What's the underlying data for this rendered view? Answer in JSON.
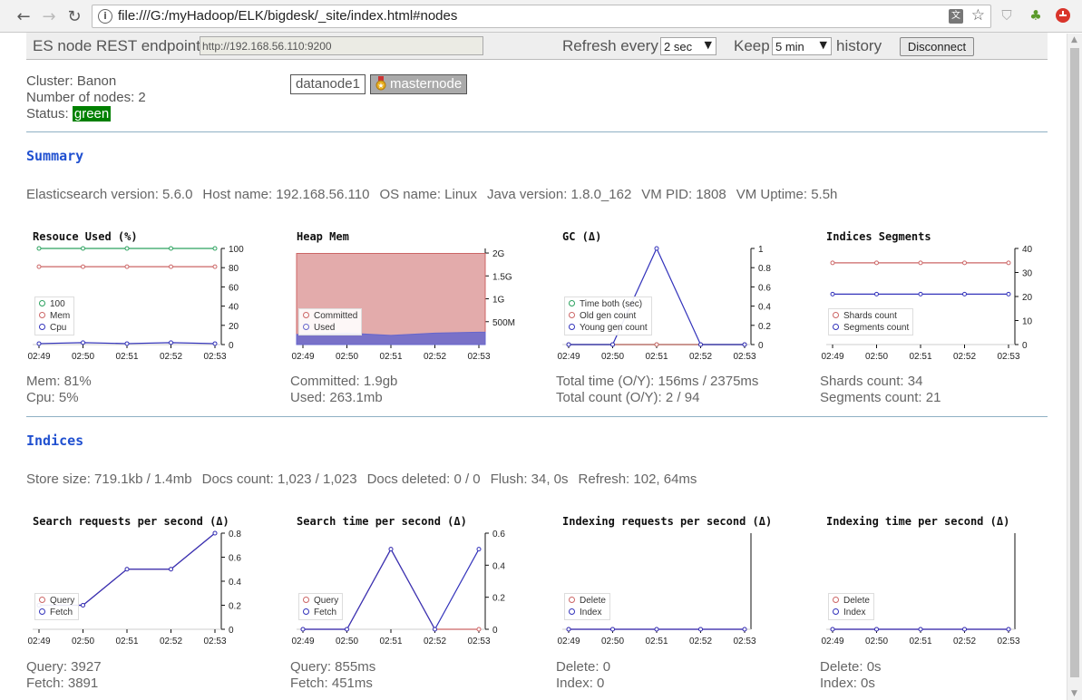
{
  "browser": {
    "url": "file:///G:/myHadoop/ELK/bigdesk/_site/index.html#nodes"
  },
  "header": {
    "endpoint_label": "ES node REST endpoint",
    "endpoint_value": "http://192.168.56.110:9200",
    "refresh_label": "Refresh every",
    "refresh_value": "2 sec",
    "keep_label": "Keep",
    "keep_value": "5 min",
    "history_label": "history",
    "disconnect_label": "Disconnect"
  },
  "cluster": {
    "name_line": "Cluster: Banon",
    "nodes_line": "Number of nodes: 2",
    "status_label": "Status:",
    "status_value": "green",
    "status_color": "#008000",
    "nodes": [
      "datanode1",
      "masternode"
    ]
  },
  "summary": {
    "title": "Summary",
    "stats": [
      "Elasticsearch version: 5.6.0",
      "Host name: 192.168.56.110",
      "OS name: Linux",
      "Java version: 1.8.0_162",
      "VM PID: 1808",
      "VM Uptime: 5.5h"
    ]
  },
  "indices": {
    "title": "Indices",
    "stats": [
      "Store size: 719.1kb / 1.4mb",
      "Docs count: 1,023 / 1,023",
      "Docs deleted: 0 / 0",
      "Flush: 34, 0s",
      "Refresh: 102, 64ms"
    ]
  },
  "chart_data": [
    {
      "id": "resources",
      "type": "line",
      "title": "Resouce Used (%)",
      "x": [
        "02:49",
        "02:50",
        "02:51",
        "02:52",
        "02:53"
      ],
      "ylim": [
        0,
        100
      ],
      "yticks": [
        "0",
        "20",
        "40",
        "60",
        "80",
        "100"
      ],
      "series": [
        {
          "name": "100",
          "color": "#2ca25f",
          "values": [
            100,
            100,
            100,
            100,
            100
          ]
        },
        {
          "name": "Mem",
          "color": "#cc6666",
          "values": [
            81,
            81,
            81,
            81,
            81
          ]
        },
        {
          "name": "Cpu",
          "color": "#3333bb",
          "values": [
            1,
            2,
            1,
            2,
            1
          ]
        }
      ],
      "metrics": [
        "Mem: 81%",
        "Cpu: 5%"
      ]
    },
    {
      "id": "heap",
      "type": "area",
      "title": "Heap Mem",
      "x": [
        "02:49",
        "02:50",
        "02:51",
        "02:52",
        "02:53"
      ],
      "ylim": [
        0,
        2.1
      ],
      "ytick_values": [
        0.5,
        1,
        1.5,
        2
      ],
      "yticks": [
        "500M",
        "1G",
        "1.5G",
        "2G"
      ],
      "series": [
        {
          "name": "Committed",
          "color": "#cc6666",
          "values": [
            1.99,
            1.99,
            1.99,
            1.99,
            1.99
          ]
        },
        {
          "name": "Used",
          "color": "#6666cc",
          "values": [
            0.22,
            0.25,
            0.2,
            0.25,
            0.27
          ]
        }
      ],
      "metrics": [
        "Committed: 1.9gb",
        "Used: 263.1mb"
      ]
    },
    {
      "id": "gc",
      "type": "line",
      "title": "GC (Δ)",
      "x": [
        "02:49",
        "02:50",
        "02:51",
        "02:52",
        "02:53"
      ],
      "ylim": [
        0,
        1
      ],
      "yticks": [
        "0",
        "0.2",
        "0.4",
        "0.6",
        "0.8",
        "1"
      ],
      "series": [
        {
          "name": "Time both (sec)",
          "color": "#2ca25f",
          "values": [
            0,
            0,
            0,
            0,
            0
          ]
        },
        {
          "name": "Old gen count",
          "color": "#cc6666",
          "values": [
            0,
            0,
            0,
            0,
            0
          ]
        },
        {
          "name": "Young gen count",
          "color": "#3333bb",
          "values": [
            0,
            0,
            1,
            0,
            0
          ]
        }
      ],
      "metrics": [
        "Total time (O/Y): 156ms / 2375ms",
        "Total count (O/Y): 2 / 94"
      ]
    },
    {
      "id": "segments",
      "type": "line",
      "title": "Indices Segments",
      "x": [
        "02:49",
        "02:50",
        "02:51",
        "02:52",
        "02:53"
      ],
      "ylim": [
        0,
        40
      ],
      "yticks": [
        "0",
        "10",
        "20",
        "30",
        "40"
      ],
      "series": [
        {
          "name": "Shards count",
          "color": "#cc6666",
          "values": [
            34,
            34,
            34,
            34,
            34
          ]
        },
        {
          "name": "Segments count",
          "color": "#3333bb",
          "values": [
            21,
            21,
            21,
            21,
            21
          ]
        }
      ],
      "metrics": [
        "Shards count: 34",
        "Segments count: 21"
      ]
    },
    {
      "id": "search-req",
      "type": "line",
      "title": "Search requests per second (Δ)",
      "x": [
        "02:49",
        "02:50",
        "02:51",
        "02:52",
        "02:53"
      ],
      "ylim": [
        0,
        0.8
      ],
      "yticks": [
        "0",
        "0.2",
        "0.4",
        "0.6",
        "0.8"
      ],
      "series": [
        {
          "name": "Query",
          "color": "#cc6666",
          "values": [
            0.2,
            0.2,
            0.5,
            0.5,
            0.8
          ]
        },
        {
          "name": "Fetch",
          "color": "#3333bb",
          "values": [
            0.2,
            0.2,
            0.5,
            0.5,
            0.8
          ]
        }
      ],
      "metrics": [
        "Query: 3927",
        "Fetch: 3891"
      ]
    },
    {
      "id": "search-time",
      "type": "line",
      "title": "Search time per second (Δ)",
      "x": [
        "02:49",
        "02:50",
        "02:51",
        "02:52",
        "02:53"
      ],
      "ylim": [
        0,
        0.6
      ],
      "yticks": [
        "0",
        "0.2",
        "0.4",
        "0.6"
      ],
      "series": [
        {
          "name": "Query",
          "color": "#cc6666",
          "values": [
            0,
            0,
            0.5,
            0,
            0
          ]
        },
        {
          "name": "Fetch",
          "color": "#3333bb",
          "values": [
            0,
            0,
            0.5,
            0,
            0.5
          ]
        }
      ],
      "metrics": [
        "Query: 855ms",
        "Fetch: 451ms"
      ]
    },
    {
      "id": "index-req",
      "type": "line",
      "title": "Indexing requests per second (Δ)",
      "x": [
        "02:49",
        "02:50",
        "02:51",
        "02:52",
        "02:53"
      ],
      "ylim": [
        0,
        1
      ],
      "yticks": [],
      "series": [
        {
          "name": "Delete",
          "color": "#cc6666",
          "values": [
            0,
            0,
            0,
            0,
            0
          ]
        },
        {
          "name": "Index",
          "color": "#3333bb",
          "values": [
            0,
            0,
            0,
            0,
            0
          ]
        }
      ],
      "metrics": [
        "Delete: 0",
        "Index: 0"
      ]
    },
    {
      "id": "index-time",
      "type": "line",
      "title": "Indexing time per second (Δ)",
      "x": [
        "02:49",
        "02:50",
        "02:51",
        "02:52",
        "02:53"
      ],
      "ylim": [
        0,
        1
      ],
      "yticks": [],
      "series": [
        {
          "name": "Delete",
          "color": "#cc6666",
          "values": [
            0,
            0,
            0,
            0,
            0
          ]
        },
        {
          "name": "Index",
          "color": "#3333bb",
          "values": [
            0,
            0,
            0,
            0,
            0
          ]
        }
      ],
      "metrics": [
        "Delete: 0s",
        "Index: 0s"
      ]
    }
  ]
}
